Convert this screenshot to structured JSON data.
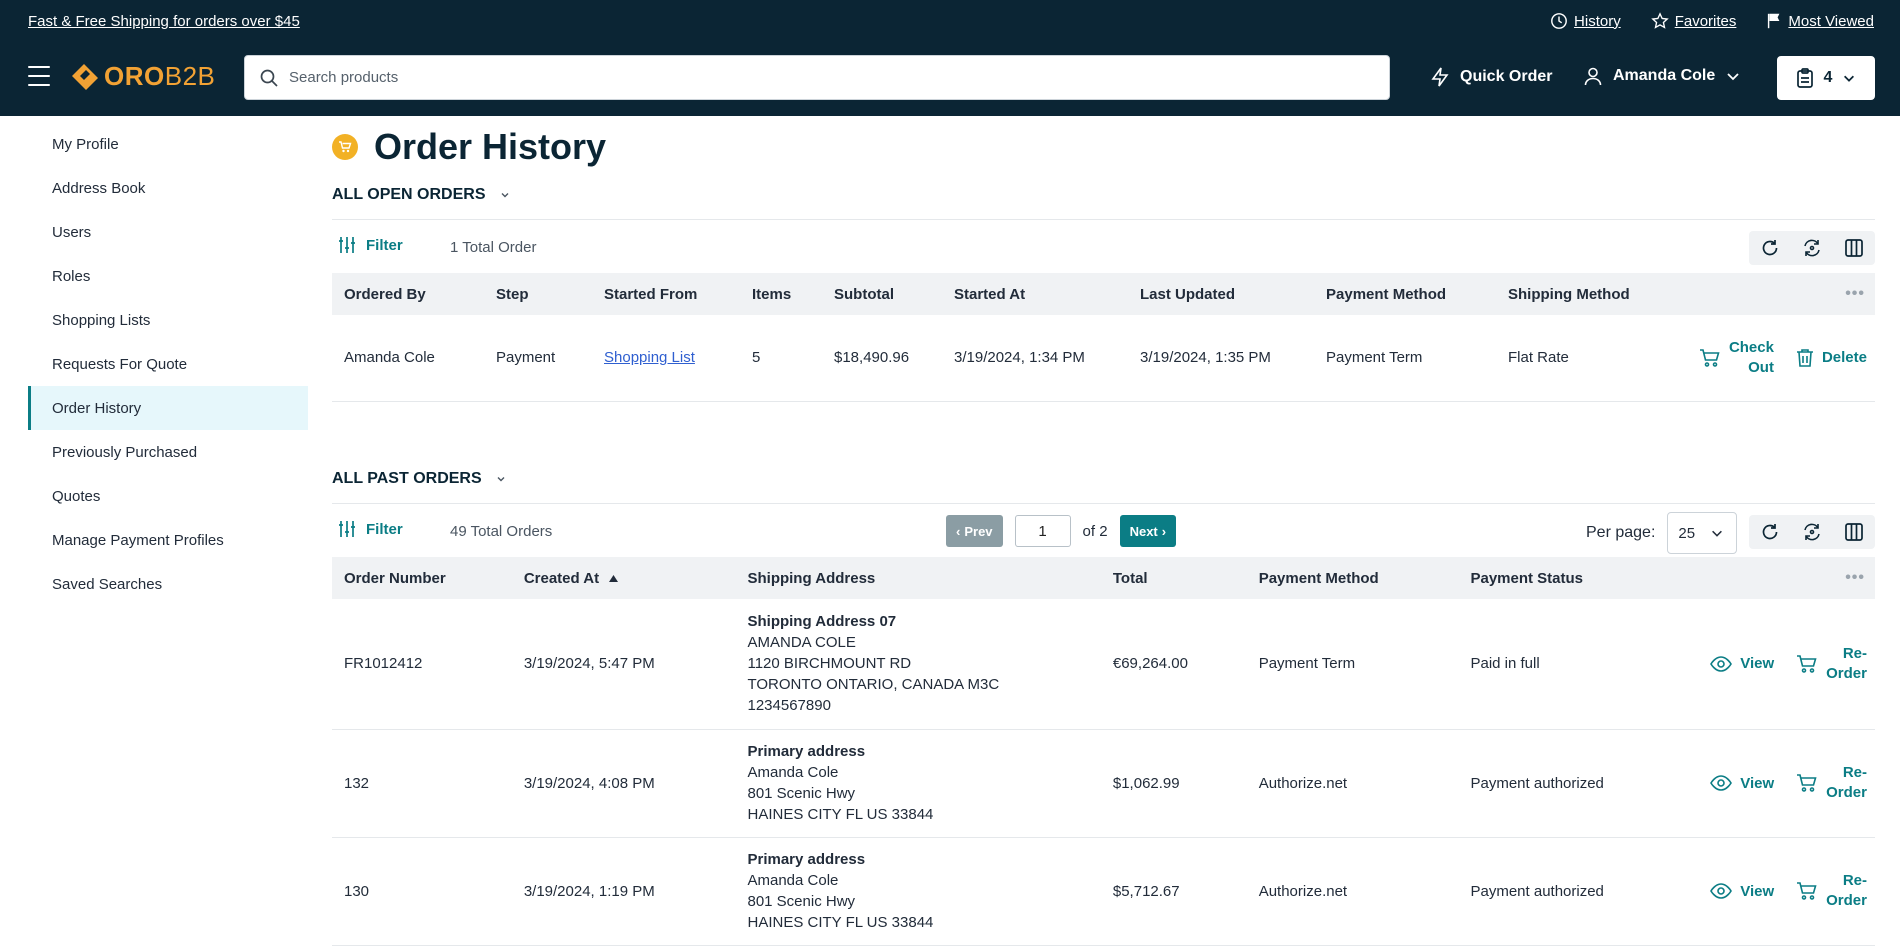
{
  "header": {
    "promo": "Fast & Free Shipping for orders over $45",
    "links": [
      {
        "label": "History",
        "icon": "clock-icon"
      },
      {
        "label": "Favorites",
        "icon": "star-icon"
      },
      {
        "label": "Most Viewed",
        "icon": "flag-icon"
      }
    ],
    "logo": {
      "part1": "ORO",
      "part2": "B2B"
    },
    "search_placeholder": "Search products",
    "quick_order": "Quick Order",
    "user_name": "Amanda Cole",
    "cart_count": "4",
    "brand_color": "#0b2534",
    "accent_color": "#0b7d85"
  },
  "sidebar": {
    "items": [
      {
        "label": "My Profile"
      },
      {
        "label": "Address Book"
      },
      {
        "label": "Users"
      },
      {
        "label": "Roles"
      },
      {
        "label": "Shopping Lists"
      },
      {
        "label": "Requests For Quote"
      },
      {
        "label": "Order History",
        "active": true
      },
      {
        "label": "Previously Purchased"
      },
      {
        "label": "Quotes"
      },
      {
        "label": "Manage Payment Profiles"
      },
      {
        "label": "Saved Searches"
      }
    ]
  },
  "page": {
    "title": "Order History"
  },
  "open_orders": {
    "heading": "ALL OPEN ORDERS",
    "filter_label": "Filter",
    "total": "1 Total Order",
    "columns": [
      "Ordered By",
      "Step",
      "Started From",
      "Items",
      "Subtotal",
      "Started At",
      "Last Updated",
      "Payment Method",
      "Shipping Method"
    ],
    "rows": [
      {
        "ordered_by": "Amanda Cole",
        "step": "Payment",
        "started_from": "Shopping List",
        "items": "5",
        "subtotal": "$18,490.96",
        "started_at": "3/19/2024, 1:34 PM",
        "last_updated": "3/19/2024, 1:35 PM",
        "payment_method": "Payment Term",
        "shipping_method": "Flat Rate",
        "checkout_line1": "Check",
        "checkout_line2": "Out",
        "delete_label": "Delete"
      }
    ]
  },
  "past_orders": {
    "heading": "ALL PAST ORDERS",
    "filter_label": "Filter",
    "total": "49 Total Orders",
    "pager": {
      "prev": "Prev",
      "page": "1",
      "of": "of 2",
      "next": "Next"
    },
    "per_page_label": "Per page:",
    "per_page_value": "25",
    "columns": [
      "Order Number",
      "Created At",
      "Shipping Address",
      "Total",
      "Payment Method",
      "Payment Status"
    ],
    "rows": [
      {
        "number": "FR1012412",
        "created": "3/19/2024, 5:47 PM",
        "address": [
          "Shipping Address 07",
          "AMANDA COLE",
          "1120 BIRCHMOUNT RD",
          "TORONTO ONTARIO, CANADA M3C",
          "1234567890"
        ],
        "total": "€69,264.00",
        "payment_method": "Payment Term",
        "payment_status": "Paid in full",
        "view_label": "View",
        "reorder_line1": "Re-",
        "reorder_line2": "Order"
      },
      {
        "number": "132",
        "created": "3/19/2024, 4:08 PM",
        "address": [
          "Primary address",
          "Amanda Cole",
          "801 Scenic Hwy",
          "HAINES CITY FL US 33844"
        ],
        "total": "$1,062.99",
        "payment_method": "Authorize.net",
        "payment_status": "Payment authorized",
        "view_label": "View",
        "reorder_line1": "Re-",
        "reorder_line2": "Order"
      },
      {
        "number": "130",
        "created": "3/19/2024, 1:19 PM",
        "address": [
          "Primary address",
          "Amanda Cole",
          "801 Scenic Hwy",
          "HAINES CITY FL US 33844"
        ],
        "total": "$5,712.67",
        "payment_method": "Authorize.net",
        "payment_status": "Payment authorized",
        "view_label": "View",
        "reorder_line1": "Re-",
        "reorder_line2": "Order"
      }
    ]
  }
}
